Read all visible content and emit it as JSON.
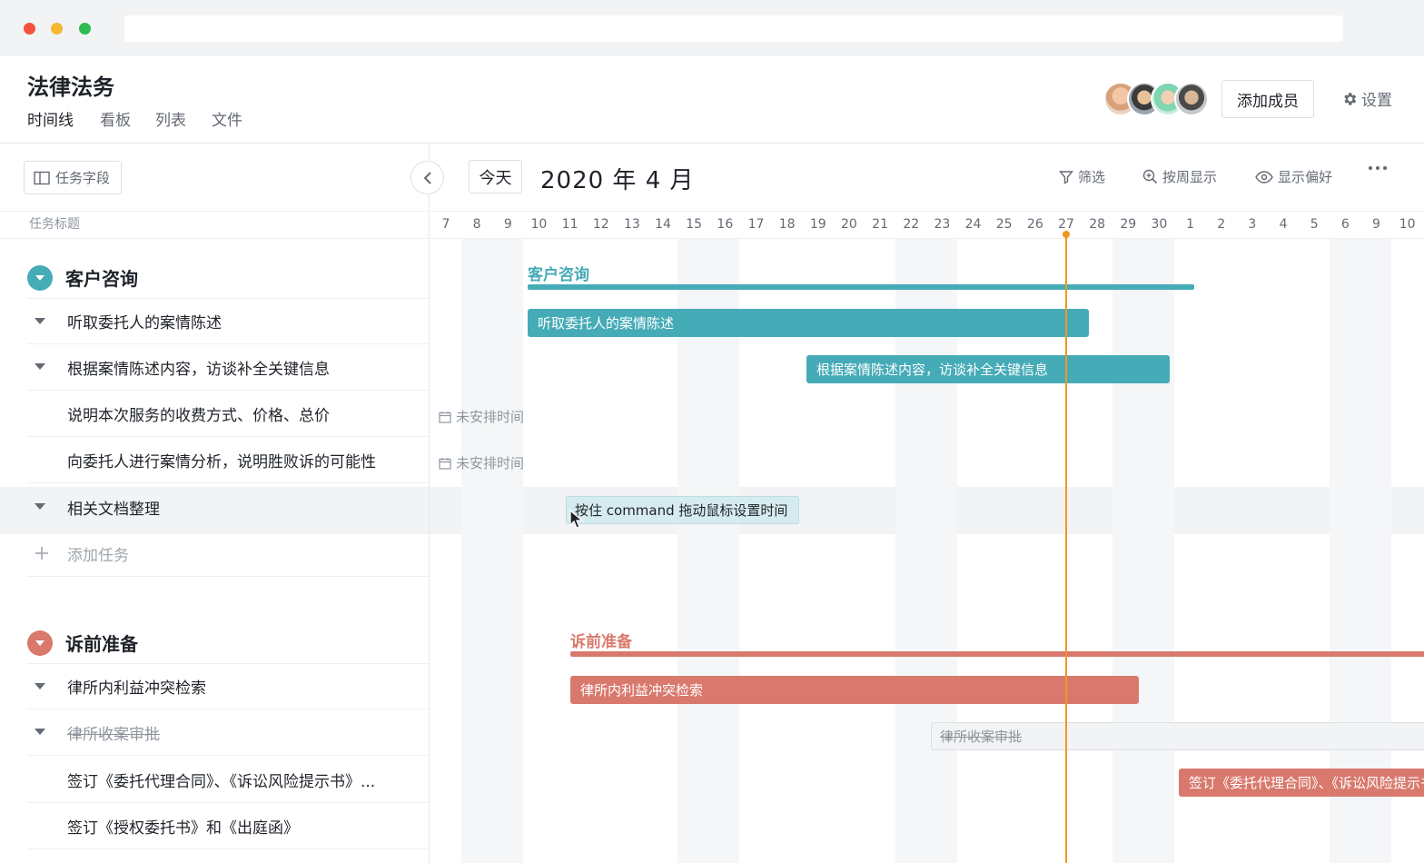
{
  "project": {
    "title": "法律法务",
    "tabs": [
      {
        "label": "时间线"
      },
      {
        "label": "看板"
      },
      {
        "label": "列表"
      },
      {
        "label": "文件"
      }
    ]
  },
  "header_actions": {
    "add_member_label": "添加成员",
    "settings_label": "设置"
  },
  "left_panel": {
    "fields_button_label": "任务字段",
    "column_header": "任务标题",
    "groups": [
      {
        "title": "客户咨询",
        "color": "#45abb7",
        "tasks": [
          {
            "label": "听取委托人的案情陈述"
          },
          {
            "label": "根据案情陈述内容，访谈补全关键信息"
          },
          {
            "label": "说明本次服务的收费方式、价格、总价"
          },
          {
            "label": "向委托人进行案情分析，说明胜败诉的可能性"
          },
          {
            "label": "相关文档整理"
          }
        ],
        "add_task_label": "添加任务"
      },
      {
        "title": "诉前准备",
        "color": "#d9796d",
        "tasks": [
          {
            "label": "律所内利益冲突检索"
          },
          {
            "label": "律所收案审批"
          },
          {
            "label": "签订《委托代理合同》、《诉讼风险提示书》..."
          },
          {
            "label": "签订《授权委托书》和《出庭函》"
          }
        ]
      }
    ]
  },
  "timeline": {
    "today_button_label": "今天",
    "month_label": "2020 年 4 月",
    "tools": [
      {
        "label": "筛选",
        "icon": "filter-icon"
      },
      {
        "label": "按周显示",
        "icon": "zoom-in-icon"
      },
      {
        "label": "显示偏好",
        "icon": "eye-icon"
      }
    ],
    "days": [
      "7",
      "8",
      "9",
      "10",
      "11",
      "12",
      "13",
      "14",
      "15",
      "16",
      "17",
      "18",
      "19",
      "20",
      "21",
      "22",
      "23",
      "24",
      "25",
      "26",
      "27",
      "28",
      "29",
      "30",
      "1",
      "2",
      "3",
      "4",
      "5",
      "6",
      "9",
      "10"
    ],
    "today": "27",
    "group_labels": [
      "客户咨询",
      "诉前准备"
    ],
    "bars": {
      "task1": "听取委托人的案情陈述",
      "task2": "根据案情陈述内容，访谈补全关键信息",
      "unscheduled": "未安排时间",
      "hint": "按住 command 拖动鼠标设置时间",
      "task6": "律所内利益冲突检索",
      "task7": "律所收案审批",
      "task8": "签订《委托代理合同》、《诉讼风险提示书》"
    }
  },
  "colors": {
    "teal": "#45abb7",
    "coral": "#d9796d",
    "today": "#f0971f"
  }
}
